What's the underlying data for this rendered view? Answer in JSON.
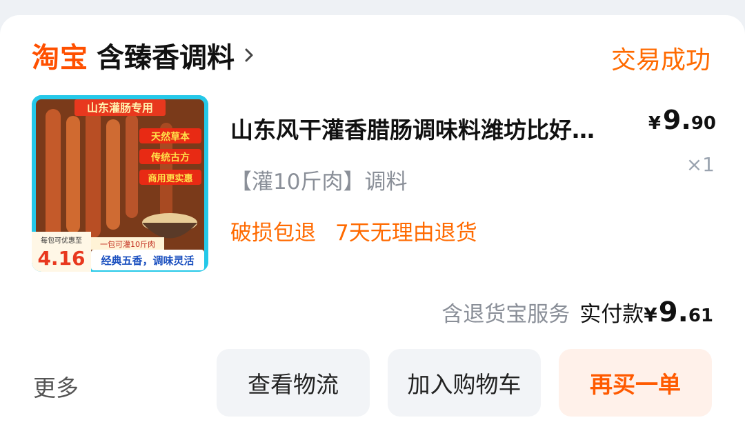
{
  "shop": {
    "platform": "淘宝",
    "name": "含臻香调料",
    "status": "交易成功"
  },
  "product": {
    "title": "山东风干灌香腊肠调味料潍坊比好…",
    "sku": "【灌10斤肉】调料",
    "price_currency": "¥",
    "price_integer": "9.",
    "price_decimal": "90",
    "quantity": "×1",
    "tags": [
      "破损包退",
      "7天无理由退货"
    ],
    "image": {
      "banner": "山东灌肠专用",
      "badge1": "天然草本",
      "badge2": "传统古方",
      "badge3": "商用更实惠",
      "promo_label": "每包可优惠至",
      "promo_value": "4.16",
      "note": "一包可灌10斤肉",
      "slogan": "经典五香，调味灵活"
    }
  },
  "payment": {
    "service": "含退货宝服务",
    "label": "实付款",
    "currency": "¥",
    "integer": "9.",
    "decimal": "61"
  },
  "actions": {
    "more": "更多",
    "logistics": "查看物流",
    "add_cart": "加入购物车",
    "rebuy": "再买一单"
  },
  "colors": {
    "accent": "#ff5000",
    "status": "#ff6a00"
  }
}
